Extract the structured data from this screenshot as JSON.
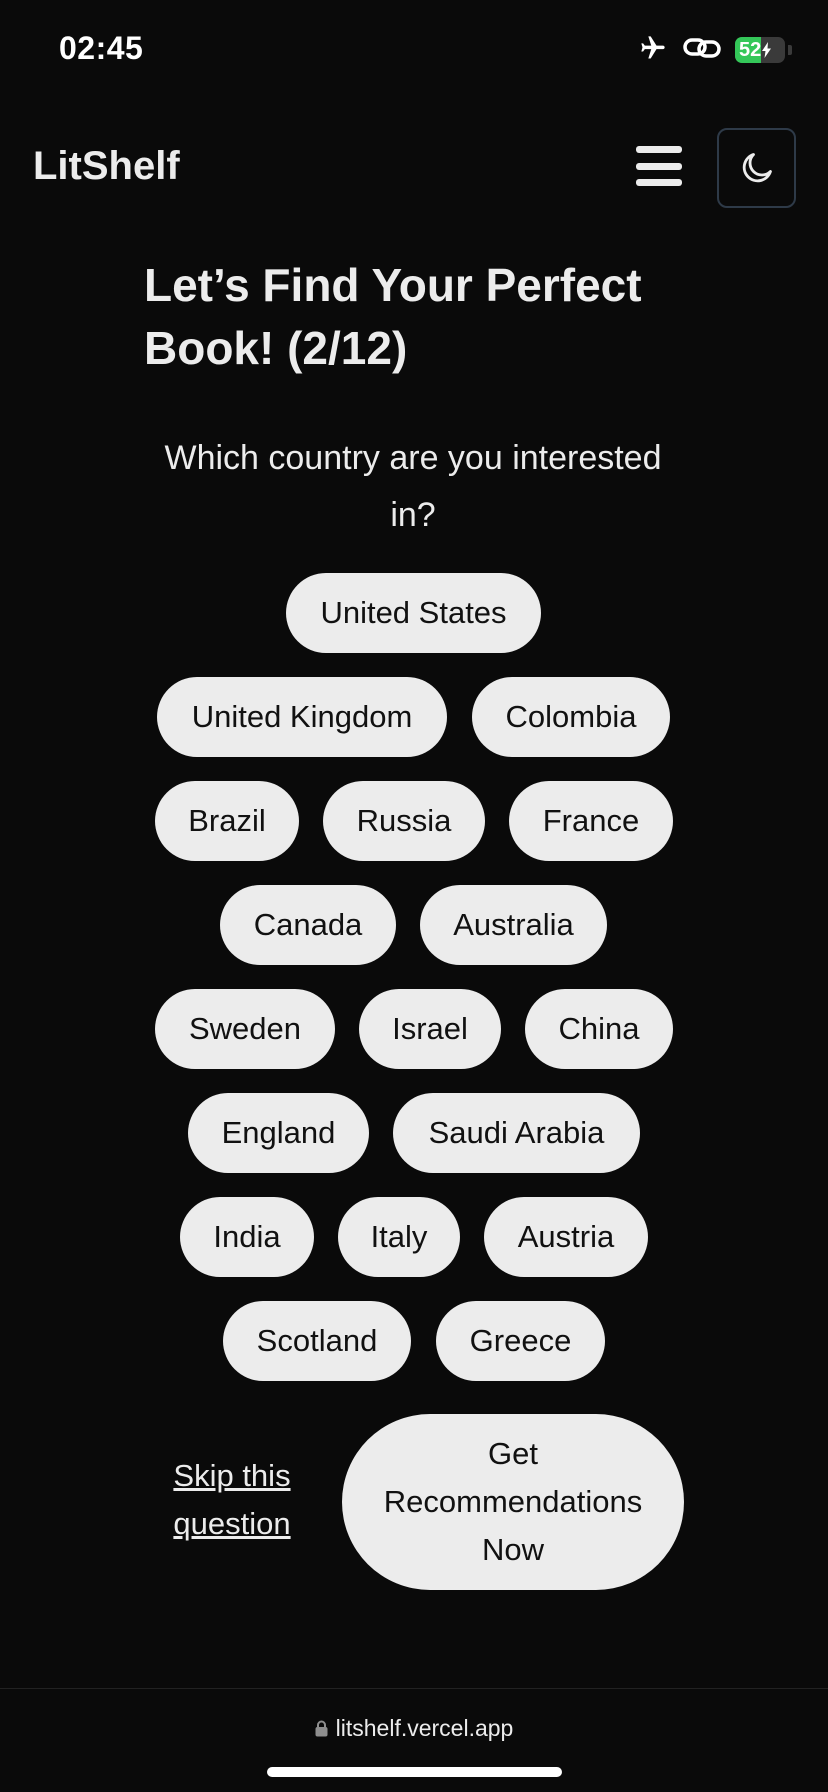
{
  "status_bar": {
    "time": "02:45",
    "battery_level": "52",
    "battery_percent": 52,
    "battery_color": "#34c759",
    "icons": [
      "airplane-icon",
      "link-icon",
      "battery-charging-icon"
    ]
  },
  "header": {
    "brand": "LitShelf",
    "menu_icon": "hamburger-menu-icon",
    "theme_icon": "moon-icon"
  },
  "quiz": {
    "title_line1": "Let’s Find Your Perfect",
    "title_line2": "Book! (2/12)",
    "question_line1": "Which country are you interested",
    "question_line2": "in?",
    "options": [
      "United States",
      "United Kingdom",
      "Colombia",
      "Brazil",
      "Russia",
      "France",
      "Canada",
      "Australia",
      "Sweden",
      "Israel",
      "China",
      "England",
      "Saudi Arabia",
      "India",
      "Italy",
      "Austria",
      "Scotland",
      "Greece"
    ],
    "skip_line1": "Skip this",
    "skip_line2": "question",
    "cta_line1": "Get",
    "cta_line2": "Recommendations",
    "cta_line3": "Now"
  },
  "browser": {
    "url": "litshelf.vercel.app",
    "lock_icon": "lock-icon"
  },
  "colors": {
    "background": "#0a0a0a",
    "text": "#ececec",
    "chip_bg": "#ececec",
    "chip_text": "#111111",
    "theme_border": "#2e3a48"
  }
}
